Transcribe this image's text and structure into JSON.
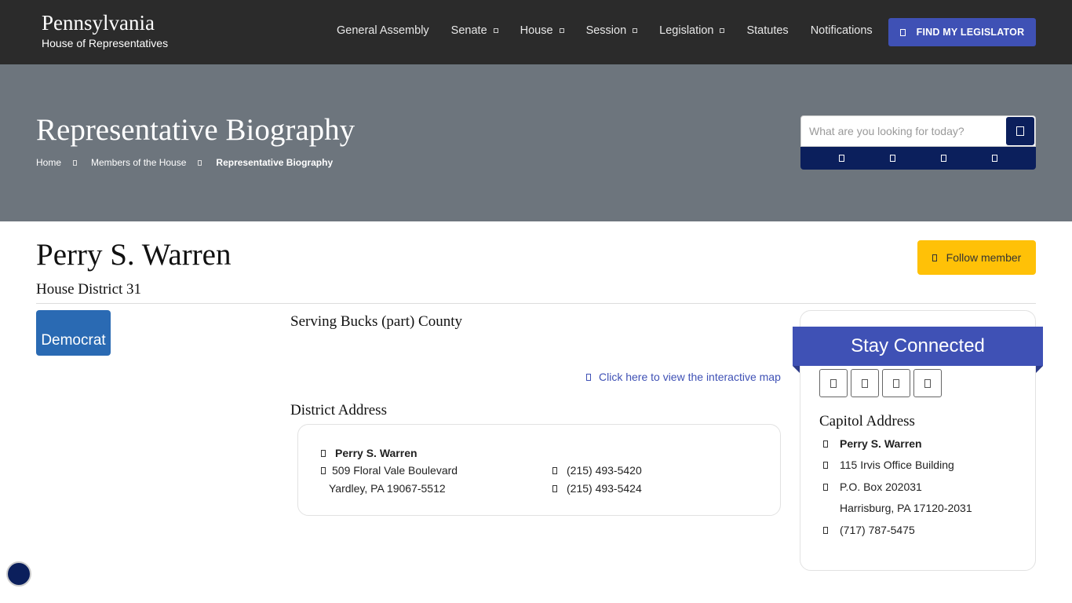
{
  "header": {
    "brand_title": "Pennsylvania",
    "brand_subtitle": "House of Representatives",
    "nav": [
      {
        "label": "General Assembly",
        "dropdown": false
      },
      {
        "label": "Senate",
        "dropdown": true
      },
      {
        "label": "House",
        "dropdown": true
      },
      {
        "label": "Session",
        "dropdown": true
      },
      {
        "label": "Legislation",
        "dropdown": true
      },
      {
        "label": "Statutes",
        "dropdown": false
      },
      {
        "label": "Notifications",
        "dropdown": false
      }
    ],
    "find_button": "FIND MY LEGISLATOR"
  },
  "banner": {
    "title": "Representative Biography",
    "breadcrumb": [
      "Home",
      "Members of the House",
      "Representative Biography"
    ],
    "search_placeholder": "What are you looking for today?"
  },
  "member": {
    "name": "Perry S. Warren",
    "district": "House District 31",
    "party": "Democrat",
    "follow_button": "Follow member",
    "serving": "Serving Bucks (part) County",
    "map_link": "Click here to view the interactive map"
  },
  "district_address": {
    "heading": "District Address",
    "name": "Perry S. Warren",
    "street": "509 Floral Vale Boulevard",
    "city": "Yardley, PA 19067-5512",
    "phone1": "(215) 493-5420",
    "phone2": "(215) 493-5424"
  },
  "sidebar": {
    "stay_connected": "Stay Connected",
    "social_icons": [
      "facebook-icon",
      "twitter-icon",
      "instagram-icon",
      "rss-icon"
    ],
    "capitol_heading": "Capitol Address",
    "capitol_name": "Perry S. Warren",
    "capitol_office": "115 Irvis Office Building",
    "capitol_pobox": "P.O. Box 202031",
    "capitol_city": "Harrisburg, PA 17120-2031",
    "capitol_phone": "(717) 787-5475"
  },
  "colors": {
    "topbar": "#2b2b2b",
    "banner": "#6d757d",
    "accent": "#3f51b5",
    "navy": "#0b1f5c",
    "follow": "#ffc107",
    "party": "#2a6ab3"
  }
}
